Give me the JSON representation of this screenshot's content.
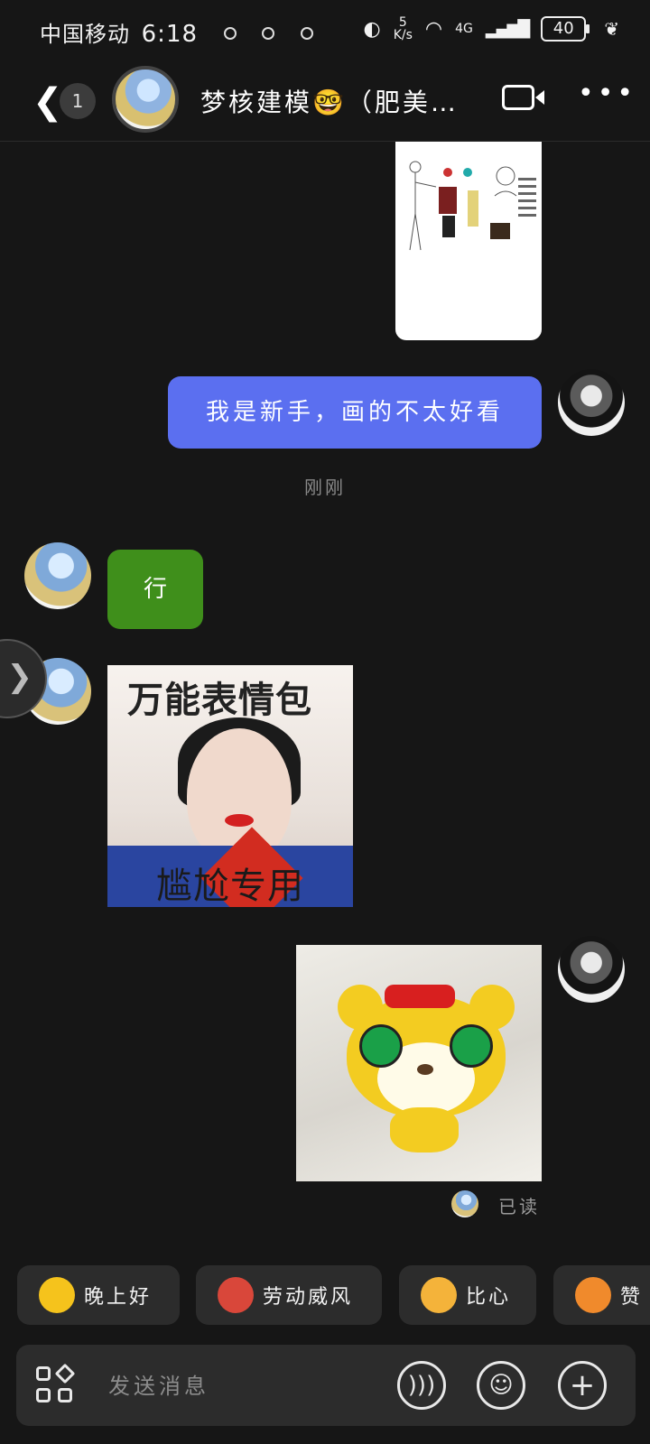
{
  "status_bar": {
    "carrier": "中国移动",
    "time": "6:18",
    "net_speed_value": "5",
    "net_speed_unit": "K/s",
    "network": "4G",
    "battery": "40"
  },
  "header": {
    "unread_count": "1",
    "title": "梦核建模🤓（肥美…"
  },
  "messages": {
    "self_text": "我是新手，画的不太好看",
    "timestamp": "刚刚",
    "other_text": "行",
    "meme_top_text": "万能表情包",
    "meme_bottom_text": "尴尬专用",
    "read_status": "已读"
  },
  "quick_replies": [
    {
      "label": "晚上好",
      "icon": "star-face-emoji",
      "color": "#f5c31c"
    },
    {
      "label": "劳动威风",
      "icon": "drum-emoji",
      "color": "#d9473a"
    },
    {
      "label": "比心",
      "icon": "heart-hands-emoji",
      "color": "#f4b33a"
    },
    {
      "label": "赞",
      "icon": "thumbs-up-emoji",
      "color": "#f08a2c"
    }
  ],
  "composer": {
    "placeholder": "发送消息"
  },
  "colors": {
    "self_bubble": "#5b6ff0",
    "other_bubble": "#3f8f1b",
    "background": "#161616"
  }
}
